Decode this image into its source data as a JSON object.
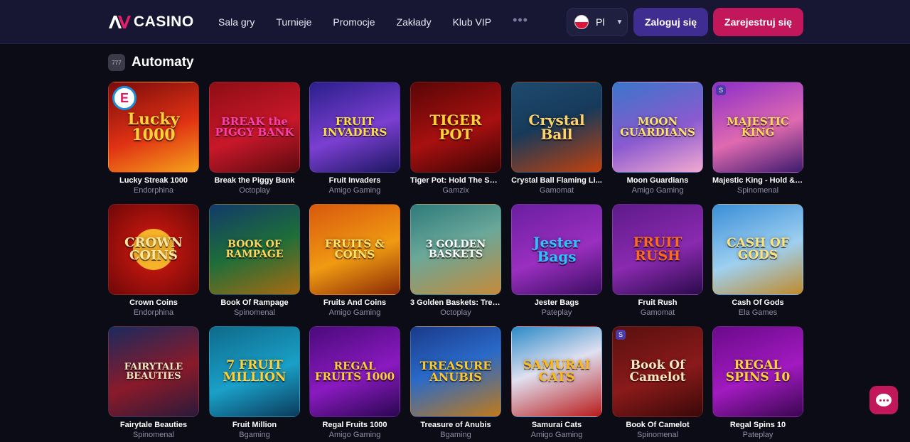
{
  "header": {
    "logo_text": "CASINO",
    "nav": [
      "Sala gry",
      "Turnieje",
      "Promocje",
      "Zakłady",
      "Klub VIP"
    ],
    "more_label": "•••",
    "language": "Pl",
    "login_label": "Zaloguj się",
    "register_label": "Zarejestruj się"
  },
  "section": {
    "title": "Automaty",
    "icon_text": "777"
  },
  "games": [
    {
      "name": "Lucky Streak 1000",
      "provider": "Endorphina",
      "art": "Lucky 1000",
      "bg": "linear-gradient(160deg,#7a0b0b,#e03214 55%,#f6a21a)",
      "color": "#ffd23a",
      "fs": 22,
      "badge": "e"
    },
    {
      "name": "Break the Piggy Bank",
      "provider": "Octoplay",
      "art": "BREAK the PIGGY BANK",
      "bg": "linear-gradient(160deg,#8e0d14,#c8182a 55%,#5a0a0e)",
      "color": "#ff3ea8",
      "fs": 15,
      "badge": ""
    },
    {
      "name": "Fruit Invaders",
      "provider": "Amigo Gaming",
      "art": "FRUIT INVADERS",
      "bg": "linear-gradient(160deg,#2a1f8a,#7b3fd2 55%,#1b1660)",
      "color": "#ffe040",
      "fs": 15,
      "badge": ""
    },
    {
      "name": "Tiger Pot: Hold The Spin",
      "provider": "Gamzix",
      "art": "TIGER POT",
      "bg": "linear-gradient(160deg,#5a0606,#a81010 55%,#3a0404)",
      "color": "#ffcf3a",
      "fs": 20,
      "badge": ""
    },
    {
      "name": "Crystal Ball Flaming Li...",
      "provider": "Gamomat",
      "art": "Crystal Ball",
      "bg": "linear-gradient(160deg,#1e4a6e,#173a5a 45%,#c2410c)",
      "color": "#ffd36b",
      "fs": 20,
      "badge": ""
    },
    {
      "name": "Moon Guardians",
      "provider": "Amigo Gaming",
      "art": "MOON GUARDIANS",
      "bg": "linear-gradient(160deg,#3a76c9,#8a5ad0 55%,#f2a9d0)",
      "color": "#ffe16a",
      "fs": 15,
      "badge": ""
    },
    {
      "name": "Majestic King - Hold & ...",
      "provider": "Spinomenal",
      "art": "MAJESTIC KING",
      "bg": "linear-gradient(160deg,#8b2fc9,#e06ab0 55%,#3d1a6e)",
      "color": "#ffd85a",
      "fs": 15,
      "badge": "s"
    },
    {
      "name": "Crown Coins",
      "provider": "Endorphina",
      "art": "CROWN COINS",
      "bg": "radial-gradient(circle at 50% 50%,#f6b22a 0 32%,#b8140e 33%,#6e0808)",
      "color": "#ffe7a0",
      "fs": 18,
      "badge": ""
    },
    {
      "name": "Book Of Rampage",
      "provider": "Spinomenal",
      "art": "BOOK OF RAMPAGE",
      "bg": "linear-gradient(160deg,#123a6a,#1e6e3a 50%,#a86a10)",
      "color": "#ffd560",
      "fs": 14,
      "badge": ""
    },
    {
      "name": "Fruits And Coins",
      "provider": "Amigo Gaming",
      "art": "FRUITS & COINS",
      "bg": "linear-gradient(160deg,#d9580e,#f09a12 55%,#8a2a06)",
      "color": "#ffe36a",
      "fs": 15,
      "badge": ""
    },
    {
      "name": "3 Golden Baskets: Trea...",
      "provider": "Octoplay",
      "art": "3 GOLDEN BASKETS",
      "bg": "linear-gradient(160deg,#2e7a7a,#6aa89a 45%,#c58a3a)",
      "color": "#ffffff",
      "fs": 14,
      "badge": ""
    },
    {
      "name": "Jester Bags",
      "provider": "Pateplay",
      "art": "Jester Bags",
      "bg": "linear-gradient(160deg,#6a1fa0,#9a2fc0 55%,#3a0d60)",
      "color": "#2fc1ff",
      "fs": 20,
      "badge": ""
    },
    {
      "name": "Fruit Rush",
      "provider": "Gamomat",
      "art": "FRUIT RUSH",
      "bg": "linear-gradient(160deg,#5e1a8a,#8a2ab0 55%,#2a0a4a)",
      "color": "#ff6a1a",
      "fs": 19,
      "badge": ""
    },
    {
      "name": "Cash Of Gods",
      "provider": "Ela Games",
      "art": "CASH OF GODS",
      "bg": "linear-gradient(160deg,#3a8ed8,#9ed0f0 55%,#c08a2a)",
      "color": "#ffe27a",
      "fs": 17,
      "badge": ""
    },
    {
      "name": "Fairytale Beauties",
      "provider": "Spinomenal",
      "art": "FAIRYTALE BEAUTIES",
      "bg": "linear-gradient(160deg,#1a2a5e,#8a1a2a 55%,#2a1a3a)",
      "color": "#f4e6c0",
      "fs": 13,
      "badge": ""
    },
    {
      "name": "Fruit Million",
      "provider": "Bgaming",
      "art": "7 FRUIT MILLION",
      "bg": "linear-gradient(160deg,#0e6a8a,#1aa0c8 55%,#0a3a5a)",
      "color": "#ffd23a",
      "fs": 17,
      "badge": ""
    },
    {
      "name": "Regal Fruits 1000",
      "provider": "Amigo Gaming",
      "art": "REGAL FRUITS 1000",
      "bg": "linear-gradient(160deg,#4a0a7a,#8a1ac0 55%,#2a0650)",
      "color": "#ffcf3a",
      "fs": 15,
      "badge": ""
    },
    {
      "name": "Treasure of Anubis",
      "provider": "Bgaming",
      "art": "TREASURE ANUBIS",
      "bg": "linear-gradient(160deg,#1a3a8a,#2a6ac8 45%,#c07a1a)",
      "color": "#ffc82a",
      "fs": 16,
      "badge": ""
    },
    {
      "name": "Samurai Cats",
      "provider": "Amigo Gaming",
      "art": "SAMURAI CATS",
      "bg": "linear-gradient(160deg,#2a8ac8,#e0e0f0 45%,#b81a1a)",
      "color": "#ffb81a",
      "fs": 17,
      "badge": ""
    },
    {
      "name": "Book Of Camelot",
      "provider": "Spinomenal",
      "art": "Book Of Camelot",
      "bg": "linear-gradient(160deg,#5a1010,#8a1a1a 55%,#3a0808)",
      "color": "#f6e6c0",
      "fs": 17,
      "badge": "s"
    },
    {
      "name": "Regal Spins 10",
      "provider": "Pateplay",
      "art": "REGAL SPINS 10",
      "bg": "linear-gradient(160deg,#6a0a8a,#a21ac0 55%,#3a0650)",
      "color": "#ffd23a",
      "fs": 17,
      "badge": ""
    }
  ],
  "chat": {
    "icon": "chat-icon"
  },
  "colors": {
    "header_bg": "#171733",
    "page_bg": "#0c0c16",
    "login": "#3f2d91",
    "register": "#c2185b"
  }
}
